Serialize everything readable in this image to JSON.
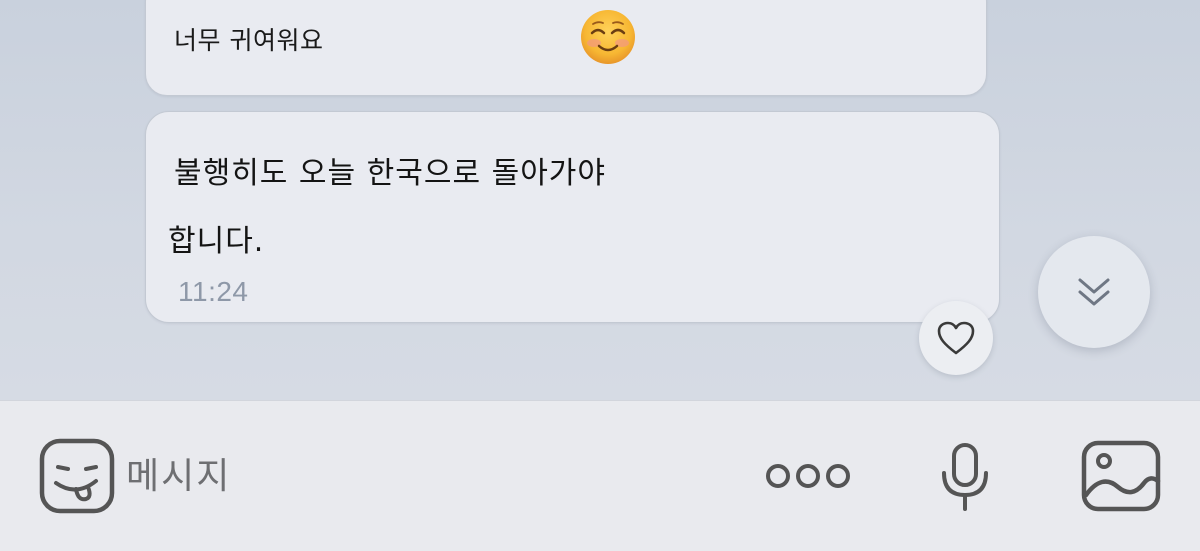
{
  "chat": {
    "messages": [
      {
        "text": "너무 귀여워요",
        "emoji": "smiling-face-with-blush"
      },
      {
        "line1": "불행히도 오늘 한국으로 돌아가야",
        "line2": "합니다.",
        "time": "11:24"
      }
    ],
    "reaction_icon": "heart-icon",
    "scroll_icon": "double-chevron-down-icon"
  },
  "composer": {
    "placeholder": "메시지",
    "icons": [
      "sticker-icon",
      "more-icon",
      "mic-icon",
      "gallery-icon"
    ]
  },
  "colors": {
    "chat_background": "#cfd6e1",
    "bubble": "#e9ebf1",
    "timestamp": "#8e98a8",
    "input_bar": "#e9eaee",
    "icon": "#555555"
  }
}
